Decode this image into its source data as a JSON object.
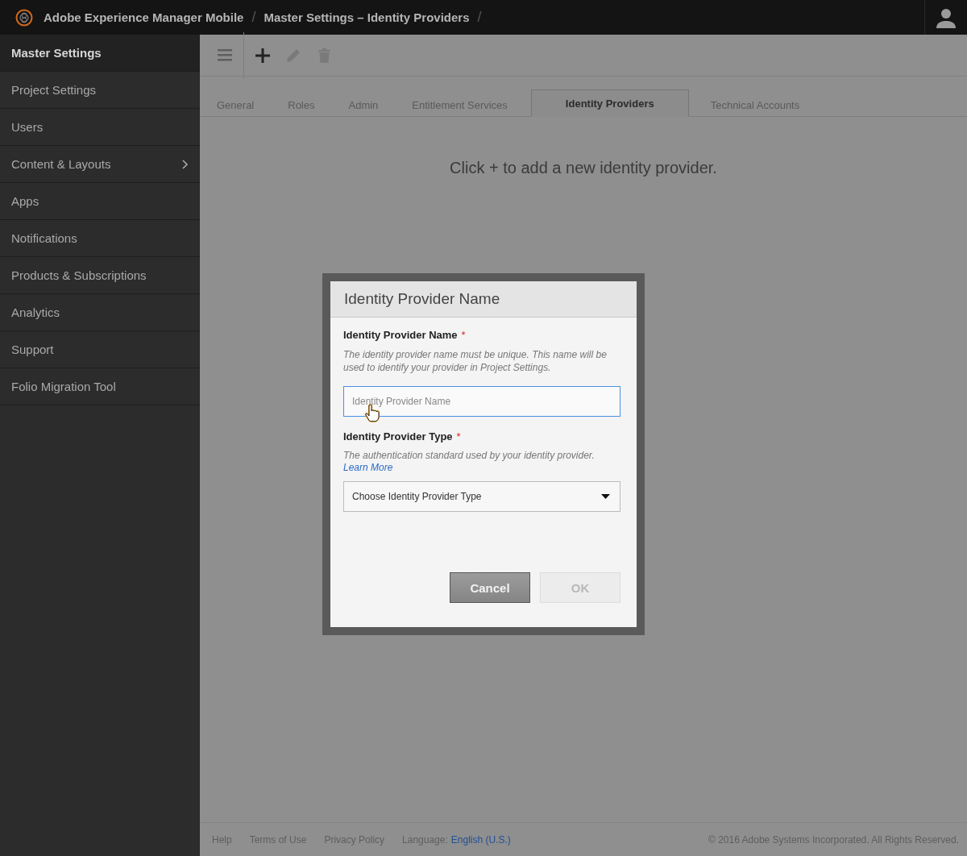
{
  "top_bar": {
    "product": "Adobe Experience Manager Mobile",
    "separator": "/",
    "breadcrumb": "Master Settings  –  Identity Providers",
    "trailing_separator": "/"
  },
  "sidebar": {
    "items": [
      {
        "label": "Master Settings",
        "selected": true,
        "has_submenu": false
      },
      {
        "label": "Project Settings",
        "selected": false,
        "has_submenu": false
      },
      {
        "label": "Users",
        "selected": false,
        "has_submenu": false
      },
      {
        "label": "Content & Layouts",
        "selected": false,
        "has_submenu": true
      },
      {
        "label": "Apps",
        "selected": false,
        "has_submenu": false
      },
      {
        "label": "Notifications",
        "selected": false,
        "has_submenu": false
      },
      {
        "label": "Products & Subscriptions",
        "selected": false,
        "has_submenu": false
      },
      {
        "label": "Analytics",
        "selected": false,
        "has_submenu": false
      },
      {
        "label": "Support",
        "selected": false,
        "has_submenu": false
      },
      {
        "label": "Folio Migration Tool",
        "selected": false,
        "has_submenu": false
      }
    ]
  },
  "toolbar": [
    {
      "kind": "menu",
      "disabled": false
    },
    {
      "kind": "add",
      "disabled": false
    },
    {
      "kind": "edit",
      "disabled": true
    },
    {
      "kind": "delete",
      "disabled": true
    }
  ],
  "tabs": [
    {
      "label": "General",
      "selected": false
    },
    {
      "label": "Roles",
      "selected": false
    },
    {
      "label": "Admin",
      "selected": false
    },
    {
      "label": "Entitlement Services",
      "selected": false
    },
    {
      "label": "Identity Providers",
      "selected": true
    },
    {
      "label": "Technical Accounts",
      "selected": false
    }
  ],
  "empty_message": "Click + to add a new identity provider.",
  "dialog": {
    "title": "Identity Provider Name",
    "name_field": {
      "label": "Identity Provider Name",
      "required_mark": "*",
      "help": "The identity provider name must be unique. This name will be used to identify your provider in Project Settings.",
      "placeholder": "Identity Provider Name",
      "focused": true
    },
    "type_field": {
      "label": "Identity Provider Type",
      "required_mark": "*",
      "help": "The authentication standard used by your identity provider.",
      "link": "Learn More",
      "value": "Choose Identity Provider Type"
    },
    "buttons": [
      {
        "label": "Cancel",
        "disabled": false
      },
      {
        "label": "OK",
        "disabled": true
      }
    ]
  },
  "footer": {
    "links": [
      "Help",
      "Terms of Use",
      "Privacy Policy"
    ],
    "language_label": "Language:",
    "language": "English (U.S.)",
    "copyright": "© 2016 Adobe Systems Incorporated. All Rights Reserved."
  }
}
